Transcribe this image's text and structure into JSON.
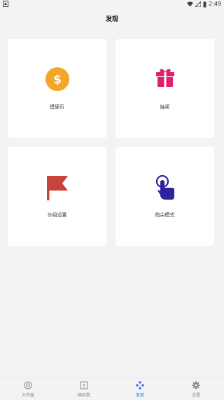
{
  "status_bar": {
    "time": "2:49"
  },
  "header": {
    "title": "发现"
  },
  "cards": [
    {
      "label": "摸硬币",
      "icon": "coin-dollar-icon"
    },
    {
      "label": "抽奖",
      "icon": "gift-icon"
    },
    {
      "label": "分组设置",
      "icon": "flag-icon"
    },
    {
      "label": "指尖模式",
      "icon": "touch-finger-icon"
    }
  ],
  "bottom_nav": {
    "items": [
      {
        "label": "大转盘",
        "icon": "wheel-icon"
      },
      {
        "label": "随机数",
        "icon": "dice-number-icon"
      },
      {
        "label": "发现",
        "icon": "gamepad-icon",
        "active": true
      },
      {
        "label": "设置",
        "icon": "gear-icon"
      }
    ]
  },
  "colors": {
    "coin": "#f2a72a",
    "gift": "#e0206e",
    "flag": "#c8433e",
    "touch": "#2f21a0",
    "active_nav": "#2f6fe3"
  }
}
